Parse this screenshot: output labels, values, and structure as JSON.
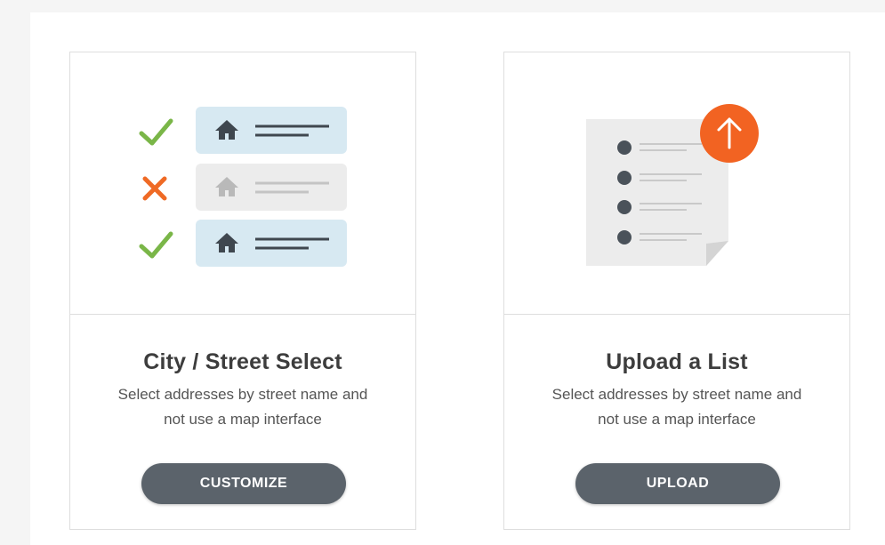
{
  "cards": [
    {
      "title": "City / Street Select",
      "description": "Select addresses by street name and not use a map interface",
      "button_label": "CUSTOMIZE",
      "illustration_icons": [
        "check-icon",
        "close-icon",
        "home-icon"
      ]
    },
    {
      "title": "Upload a List",
      "description": "Select addresses by street name and not use a map interface",
      "button_label": "UPLOAD",
      "illustration_icons": [
        "document-list-icon",
        "upload-arrow-icon"
      ]
    }
  ],
  "colors": {
    "check": "#7ab648",
    "cross": "#ef6a25",
    "row_blue": "#d7e9f2",
    "row_gray": "#ececec",
    "upload_circle": "#f26322",
    "button_bg": "#5b636b",
    "title_text": "#3d3d3d"
  }
}
